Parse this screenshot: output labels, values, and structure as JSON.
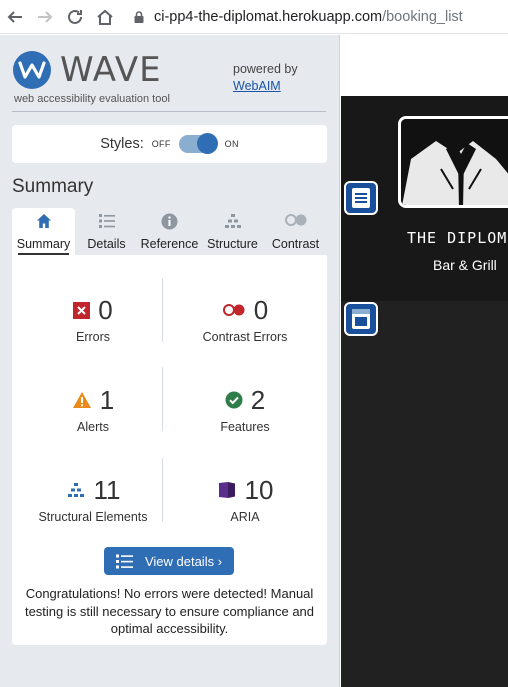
{
  "browser": {
    "url_host": "ci-pp4-the-diplomat.herokuapp.com",
    "url_path": "/booking_list"
  },
  "wave": {
    "logo_text": "WAVE",
    "tagline": "web accessibility evaluation tool",
    "powered_by": "powered by",
    "webaim_link": "WebAIM",
    "styles_label": "Styles:",
    "styles_off": "OFF",
    "styles_on": "ON",
    "section_title": "Summary",
    "tabs": [
      {
        "label": "Summary",
        "icon": "home-icon"
      },
      {
        "label": "Details",
        "icon": "list-icon"
      },
      {
        "label": "Reference",
        "icon": "info-icon"
      },
      {
        "label": "Structure",
        "icon": "structure-icon"
      },
      {
        "label": "Contrast",
        "icon": "contrast-icon"
      }
    ],
    "stats": {
      "errors": {
        "value": "0",
        "label": "Errors",
        "color": "#c0262c"
      },
      "contrast_errors": {
        "value": "0",
        "label": "Contrast Errors",
        "color": "#c0262c"
      },
      "alerts": {
        "value": "1",
        "label": "Alerts",
        "color": "#e8891a"
      },
      "features": {
        "value": "2",
        "label": "Features",
        "color": "#2f7d4a"
      },
      "structural": {
        "value": "11",
        "label": "Structural Elements",
        "color": "#2f6db5"
      },
      "aria": {
        "value": "10",
        "label": "ARIA",
        "color": "#5a2d8a"
      }
    },
    "view_details": "View details ›",
    "congrats": "Congratulations! No errors were detected! Manual testing is still necessary to ensure compliance and optimal accessibility."
  },
  "page": {
    "title": "THE DIPLOM",
    "subtitle": "Bar & Grill"
  }
}
